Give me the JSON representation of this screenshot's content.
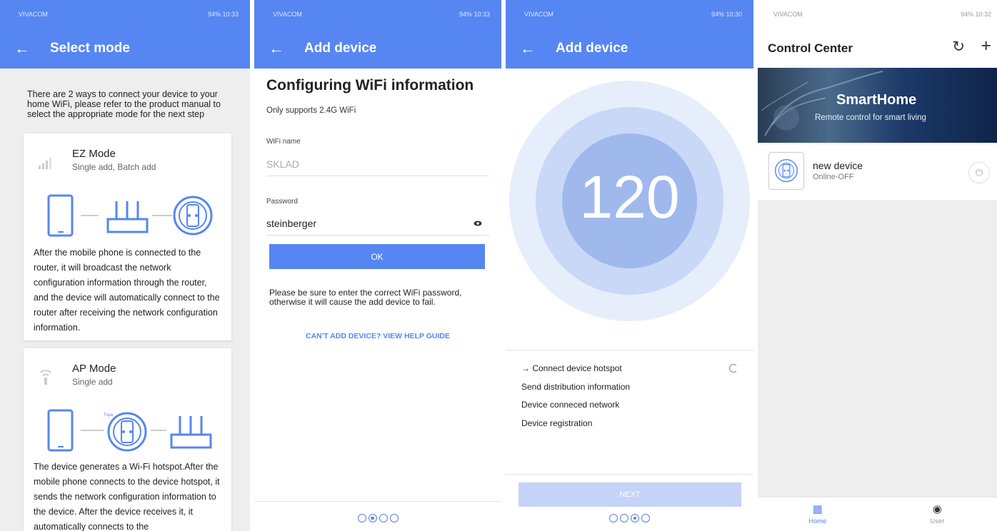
{
  "panel1": {
    "status": {
      "carrier": "VIVACOM",
      "battery_time": "94% 10:33"
    },
    "title": "Select mode",
    "intro": "There are 2 ways to connect your device to your home WiFi, please refer to the product manual to select the appropriate mode for the next step",
    "ez": {
      "title": "EZ Mode",
      "subtitle": "Single add, Batch add",
      "description": "After the mobile phone is connected to the router, it will broadcast the network configuration information through the router, and the device will automatically connect to the router after receiving the network configuration information."
    },
    "ap": {
      "title": "AP Mode",
      "subtitle": "Single add",
      "hotspot_label": "Tuya",
      "description": "The device generates a Wi-Fi hotspot.After the mobile phone connects to the device hotspot, it sends the network configuration information to the device. After the device receives it, it automatically connects to the"
    }
  },
  "panel2": {
    "status": {
      "carrier": "VIVACOM",
      "battery_time": "94% 10:33"
    },
    "title": "Add device",
    "heading": "Configuring WiFi information",
    "subheading": "Only supports 2.4G WiFi",
    "wifi_label": "WiFi name",
    "wifi_value": "SKLAD",
    "password_label": "Password",
    "password_value": "steinberger",
    "ok_label": "OK",
    "warning": "Please be sure to enter the correct WiFi password, otherwise it will cause the add device to fail.",
    "help_link": "CAN'T ADD DEVICE? VIEW HELP GUIDE",
    "active_step": 2,
    "total_steps": 4
  },
  "panel3": {
    "status": {
      "carrier": "VIVACOM",
      "battery_time": "94% 10:30"
    },
    "title": "Add device",
    "countdown": "120",
    "steps": [
      "→ Connect device hotspot",
      "Send distribution information",
      "Device conneced network",
      "Device registration"
    ],
    "next_label": "NEXT",
    "active_step": 3,
    "total_steps": 4
  },
  "panel4": {
    "status": {
      "carrier": "VIVACOM",
      "battery_time": "94% 10:32"
    },
    "title": "Control Center",
    "banner_title": "SmartHome",
    "banner_subtitle": "Remote control for smart living",
    "device_name": "new device",
    "device_status": "Online-OFF",
    "nav_home": "Home",
    "nav_user": "User"
  },
  "colors": {
    "primary": "#5686f2",
    "disabled": "#c4d3f7",
    "ring_outer": "#e6eefc",
    "ring_mid": "#c9d8f6",
    "ring_inner": "#9fb9ec"
  },
  "icons": [
    "back-arrow-icon",
    "signal-icon",
    "phone-icon",
    "router-icon",
    "smart-plug-icon",
    "eye-icon",
    "spinner-icon",
    "refresh-icon",
    "plus-icon",
    "power-icon",
    "grid-icon",
    "user-icon"
  ]
}
